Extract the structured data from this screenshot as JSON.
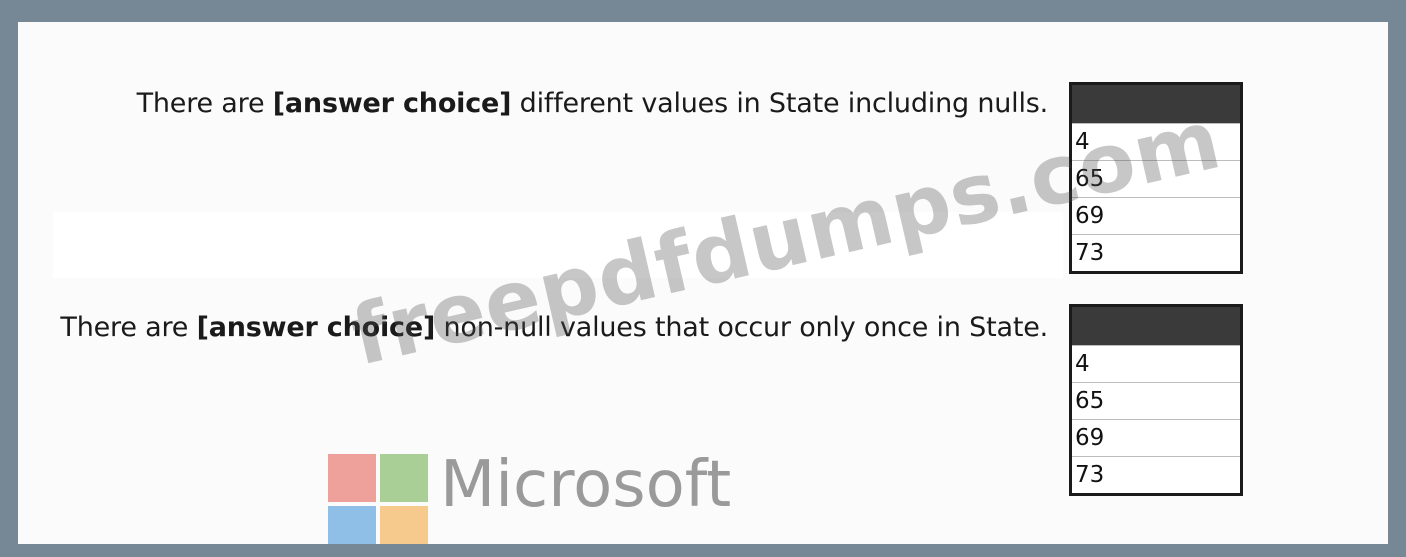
{
  "statements": [
    {
      "prefix": "There are ",
      "bold": "[answer choice]",
      "suffix": " different values in State including nulls.",
      "options": [
        "4",
        "65",
        "69",
        "73"
      ]
    },
    {
      "prefix": "There are ",
      "bold": "[answer choice]",
      "suffix": " non-null values that occur only once in State.",
      "options": [
        "4",
        "65",
        "69",
        "73"
      ]
    }
  ],
  "watermark": "freepdfdumps.com",
  "logo": {
    "text": "Microsoft",
    "icon": "microsoft-logo-icon",
    "colors": {
      "red": "#eea19a",
      "green": "#a9cf96",
      "blue": "#8fbfe6",
      "yellow": "#f6c98c"
    }
  },
  "colors": {
    "outer_frame": "#768796",
    "panel": "#fbfbfb",
    "dropdown_header": "#3a3a3a"
  }
}
